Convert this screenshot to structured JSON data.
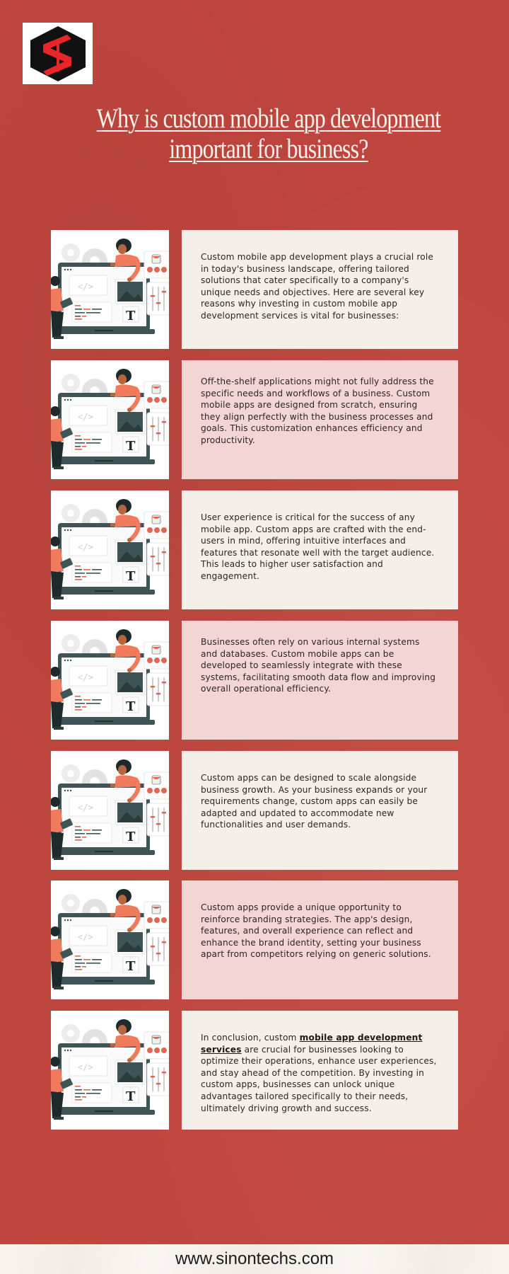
{
  "brand": {
    "logo_icon": "sinontechs-hexagon-s-logo",
    "colors": {
      "background": "#c0463e",
      "logo_red": "#e8262a",
      "logo_black": "#111111"
    }
  },
  "header": {
    "title": "Why is custom mobile app development important for business?"
  },
  "illustration": {
    "icon": "web-development-illustration",
    "description": "Developers building an app on a laptop screen with code, image and text blocks"
  },
  "sections": [
    {
      "style": "cream",
      "text": "Custom mobile app development plays a crucial role in today's business landscape, offering tailored solutions that cater specifically to a company's unique needs and objectives. Here are several key reasons why investing in custom mobile app development services is vital for businesses:"
    },
    {
      "style": "pink",
      "text": "Off-the-shelf applications might not fully address the specific needs and workflows of a business. Custom mobile apps are designed from scratch, ensuring they align perfectly with the business processes and goals. This customization enhances efficiency and productivity."
    },
    {
      "style": "cream",
      "text": "User experience is critical for the success of any mobile app. Custom apps are crafted with the end-users in mind, offering intuitive interfaces and features that resonate well with the target audience. This leads to higher user satisfaction and engagement."
    },
    {
      "style": "pink",
      "text": "Businesses often rely on various internal systems and databases. Custom mobile apps can be developed to seamlessly integrate with these systems, facilitating smooth data flow and improving overall operational efficiency."
    },
    {
      "style": "cream",
      "text": "Custom apps can be designed to scale alongside business growth. As your business expands or your requirements change, custom apps can easily be adapted and updated to accommodate new functionalities and user demands."
    },
    {
      "style": "pink",
      "text": "Custom apps provide a unique opportunity to reinforce branding strategies. The app's design, features, and overall experience can reflect and enhance the brand identity, setting your business apart from competitors relying on generic solutions."
    },
    {
      "style": "cream",
      "text_before": "In conclusion, custom ",
      "link_text": "mobile app development services",
      "text_after": " are crucial for businesses looking to optimize their operations, enhance user experiences, and stay ahead of the competition. By investing in custom apps, businesses can unlock unique advantages tailored specifically to their needs, ultimately driving growth and success."
    }
  ],
  "footer": {
    "website": "www.sinontechs.com"
  }
}
